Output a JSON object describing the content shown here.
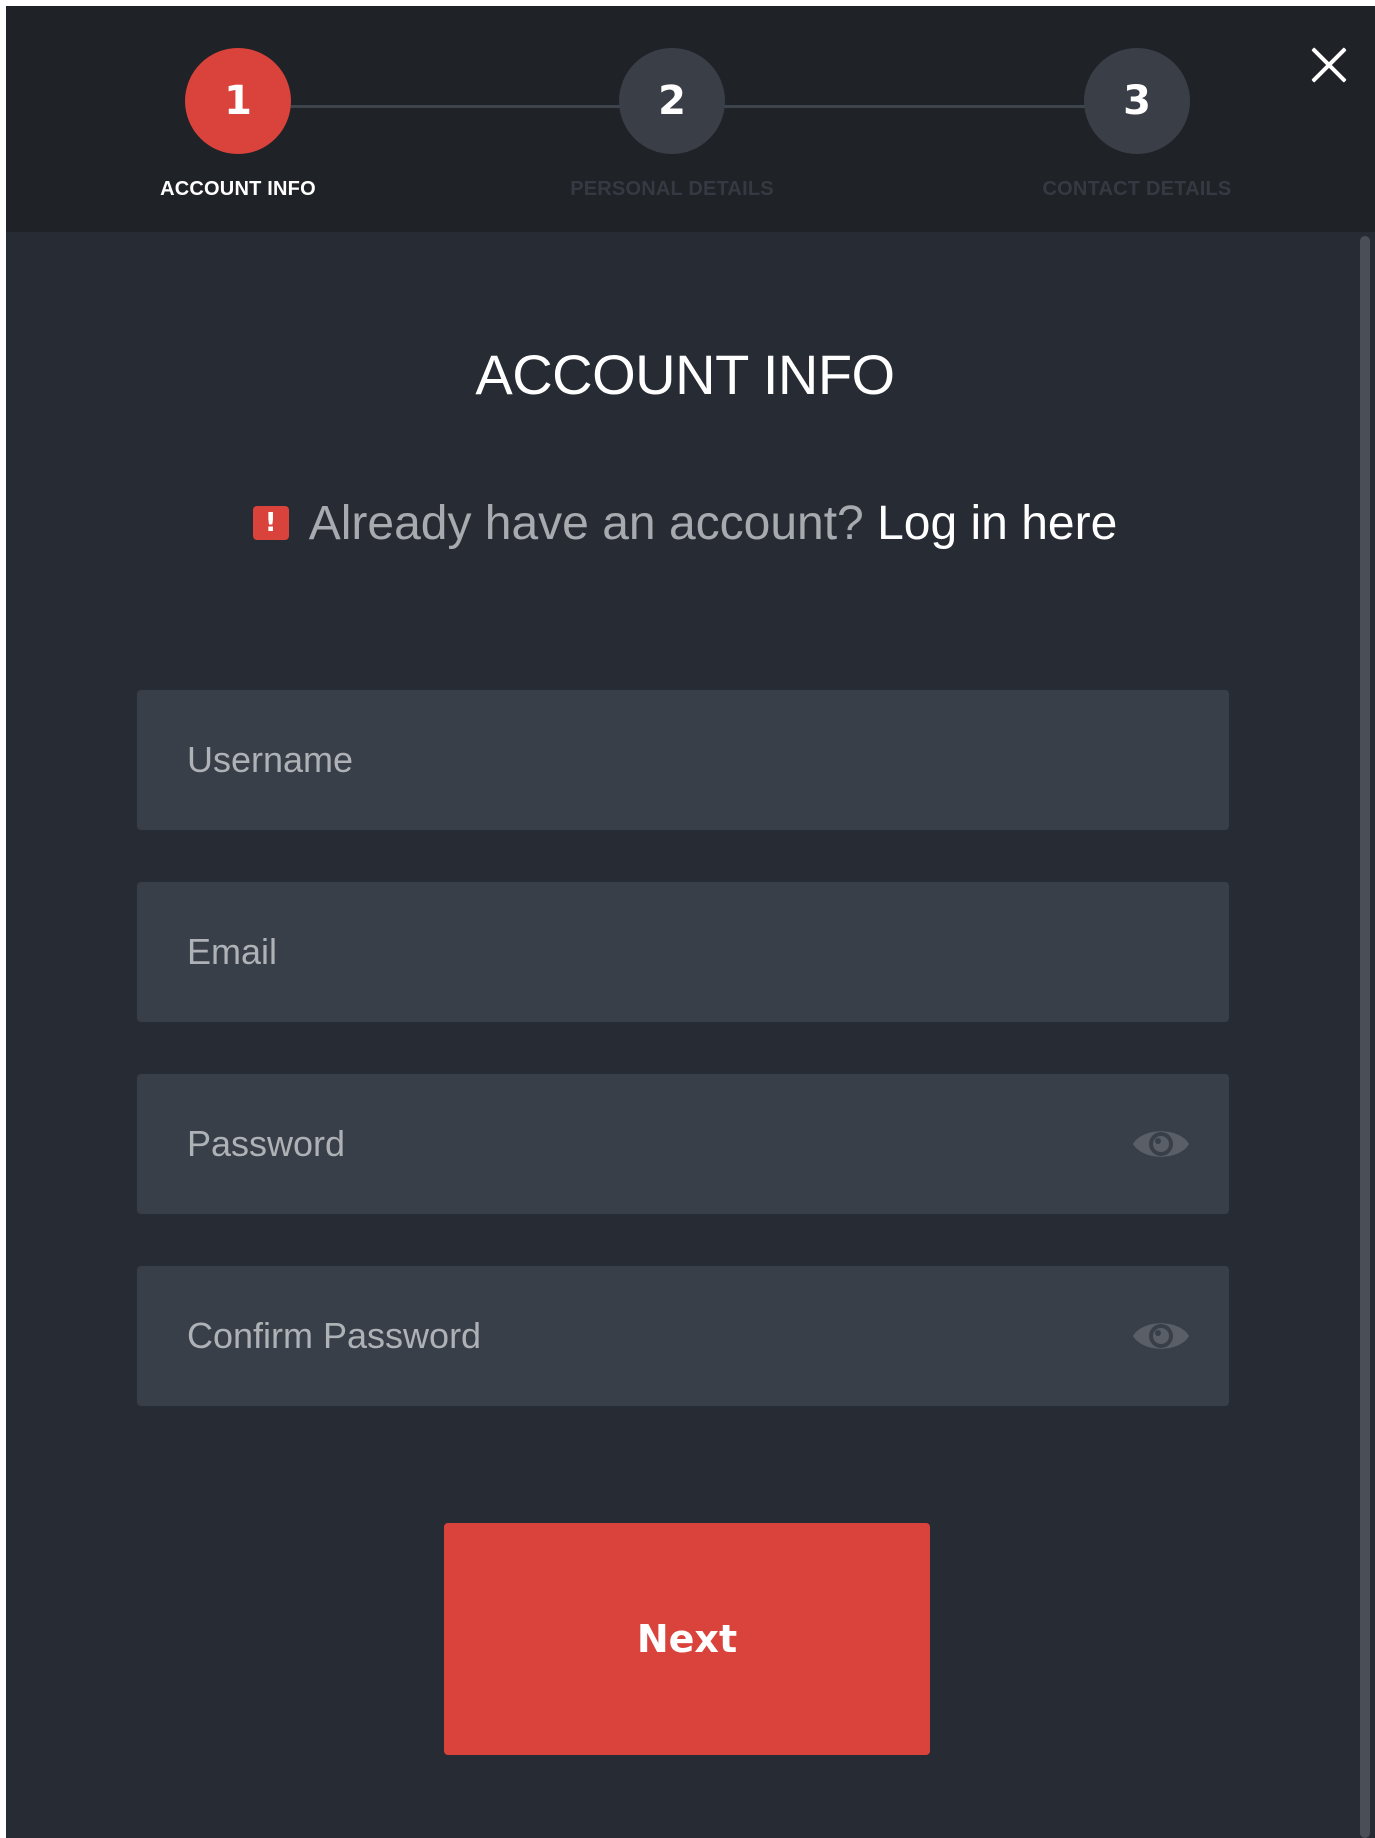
{
  "stepper": {
    "steps": [
      {
        "number": "1",
        "label": "ACCOUNT INFO",
        "active": true
      },
      {
        "number": "2",
        "label": "PERSONAL DETAILS",
        "active": false
      },
      {
        "number": "3",
        "label": "CONTACT DETAILS",
        "active": false
      }
    ]
  },
  "icons": {
    "close": "close-icon",
    "alert": "exclamation-icon",
    "password_toggle": "eye-icon"
  },
  "form": {
    "title": "ACCOUNT INFO",
    "login_prompt": "Already have an account?",
    "login_link": "Log in here",
    "alert_glyph": "!",
    "fields": [
      {
        "placeholder": "Username",
        "value": ""
      },
      {
        "placeholder": "Email",
        "value": ""
      },
      {
        "placeholder": "Password",
        "value": ""
      },
      {
        "placeholder": "Confirm Password",
        "value": ""
      }
    ],
    "next_label": "Next"
  },
  "colors": {
    "accent": "#d9433b",
    "header_bg": "#1f2227",
    "body_bg": "#272c34",
    "field_bg": "#393f48"
  }
}
